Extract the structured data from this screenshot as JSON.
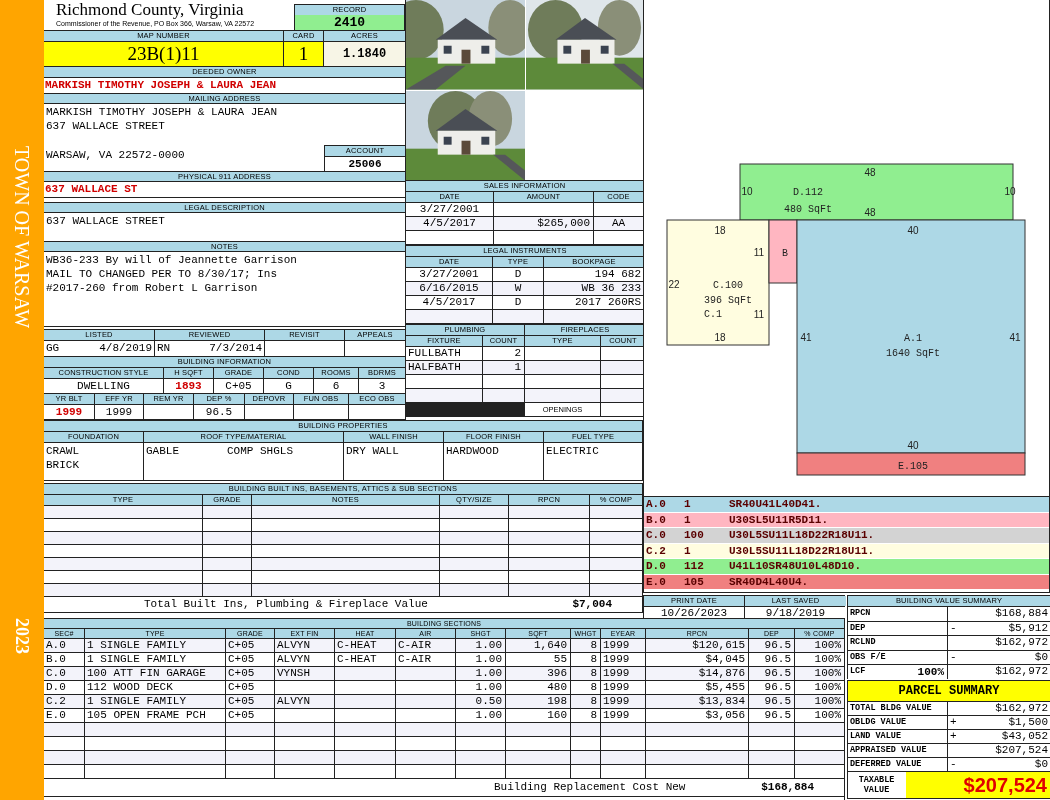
{
  "sidebar": {
    "town": "TOWN OF WARSAW",
    "year": "2023"
  },
  "header": {
    "county": "Richmond County, Virginia",
    "address": "Commissioner of the Revenue, PO Box 366, Warsaw, VA 22572"
  },
  "record": {
    "label": "RECORD",
    "value": "2410"
  },
  "map_number": {
    "label": "MAP NUMBER",
    "value": "23B(1)11"
  },
  "card": {
    "label": "CARD",
    "value": "1"
  },
  "acres": {
    "label": "ACRES",
    "value": "1.1840"
  },
  "deeded_owner": {
    "label": "DEEDED OWNER",
    "value": "MARKISH TIMOTHY JOSEPH & LAURA JEAN"
  },
  "mailing_address": {
    "label": "MAILING ADDRESS",
    "lines": [
      "MARKISH TIMOTHY JOSEPH & LAURA JEAN",
      "637 WALLACE STREET"
    ],
    "city_line": "WARSAW, VA 22572-0000"
  },
  "account": {
    "label": "ACCOUNT",
    "value": "25006"
  },
  "physical_address": {
    "label": "PHYSICAL 911 ADDRESS",
    "value": "637 WALLACE ST"
  },
  "legal_description": {
    "label": "LEGAL DESCRIPTION",
    "value": "637 WALLACE STREET"
  },
  "notes": {
    "label": "NOTES",
    "lines": [
      "WB36-233 By will of Jeannette Garrison",
      "MAIL TO CHANGED PER TO 8/30/17; Ins",
      "#2017-260 from Robert L Garrison"
    ]
  },
  "review": {
    "columns": [
      "LISTED",
      "REVIEWED",
      "REVISIT",
      "APPEALS"
    ],
    "listed_by": "GG",
    "listed_date": "4/8/2019",
    "reviewed_by": "RN",
    "reviewed_date": "7/3/2014"
  },
  "building_information": {
    "title": "BUILDING INFORMATION",
    "construction": [
      {
        "label": "CONSTRUCTION STYLE",
        "value": "DWELLING",
        "highlighted": false
      },
      {
        "label": "H SQFT",
        "value": "1893",
        "highlighted": true
      },
      {
        "label": "GRADE",
        "value": "C+05",
        "highlighted": false
      },
      {
        "label": "COND",
        "value": "G",
        "highlighted": false
      },
      {
        "label": "ROOMS",
        "value": "6",
        "highlighted": false
      },
      {
        "label": "BDRMS",
        "value": "3",
        "highlighted": false
      }
    ],
    "age": [
      {
        "label": "YR BLT",
        "value": "1999",
        "highlighted": true
      },
      {
        "label": "EFF YR",
        "value": "1999",
        "highlighted": false
      },
      {
        "label": "REM YR"
      },
      {
        "label": "DEP %",
        "value": "96.5",
        "highlighted": false
      },
      {
        "label": "DEPOVR"
      },
      {
        "label": "FUN OBS"
      },
      {
        "label": "ECO OBS"
      }
    ]
  },
  "sales": {
    "title": "SALES INFORMATION",
    "columns": [
      "DATE",
      "AMOUNT",
      "CODE"
    ],
    "rows": [
      {
        "date": "3/27/2001"
      },
      {
        "date": "4/5/2017",
        "amount": "$265,000",
        "code": "AA"
      }
    ]
  },
  "legal_instruments": {
    "title": "LEGAL INSTRUMENTS",
    "columns": [
      "DATE",
      "TYPE",
      "BOOKPAGE"
    ],
    "rows": [
      {
        "date": "3/27/2001",
        "type": "D",
        "bookpage": "194 682"
      },
      {
        "date": "6/16/2015",
        "type": "W",
        "bookpage": "WB 36 233"
      },
      {
        "date": "4/5/2017",
        "type": "D",
        "bookpage": "2017 260RS"
      }
    ]
  },
  "plumbing": {
    "title": "PLUMBING",
    "columns": [
      "FIXTURE",
      "COUNT"
    ],
    "rows": [
      {
        "fixture": "FULLBATH",
        "count": "2"
      },
      {
        "fixture": "HALFBATH",
        "count": "1"
      }
    ]
  },
  "fireplaces": {
    "title": "FIREPLACES",
    "columns": [
      "TYPE",
      "COUNT"
    ],
    "openings_label": "OPENINGS"
  },
  "building_properties": {
    "title": "BUILDING PROPERTIES",
    "columns": [
      {
        "label": "FOUNDATION",
        "values": [
          "CRAWL",
          "BRICK"
        ]
      },
      {
        "label": "ROOF TYPE/MATERIAL",
        "values": [
          "GABLE",
          "COMP SHGLS"
        ]
      },
      {
        "label": "WALL FINISH",
        "values": [
          "DRY WALL"
        ]
      },
      {
        "label": "FLOOR FINISH",
        "values": [
          "HARDWOOD"
        ]
      },
      {
        "label": "FUEL TYPE",
        "values": [
          "ELECTRIC"
        ]
      }
    ]
  },
  "built_ins": {
    "title": "BUILDING BUILT INS, BASEMENTS, ATTICS & SUB SECTIONS",
    "columns": [
      "TYPE",
      "GRADE",
      "NOTES",
      "QTY/SIZE",
      "RPCN",
      "% COMP"
    ],
    "total_label": "Total Built Ins, Plumbing & Fireplace Value",
    "total_value": "$7,004"
  },
  "sketch": {
    "areas": [
      {
        "code": "D.112",
        "sqft": "480 SqFt",
        "color": "#90ee90",
        "dims": [
          "48",
          "10",
          "10",
          "48"
        ]
      },
      {
        "code": "C.100",
        "sqft": "396 SqFt",
        "sub": "C.1",
        "color": "#fffde0",
        "dims": [
          "18",
          "11",
          "22",
          "11",
          "18"
        ]
      },
      {
        "code": "B",
        "color": "#ffb6c1"
      },
      {
        "code": "A.1",
        "sqft": "1640 SqFt",
        "color": "#add8e6",
        "dims": [
          "40",
          "41",
          "41",
          "40"
        ]
      },
      {
        "code": "E.105",
        "color": "#f08080"
      }
    ]
  },
  "legend": [
    {
      "section": "A.0",
      "code": "1",
      "traverse": "SR40U41L40D41.",
      "color": "#add8e6"
    },
    {
      "section": "B.0",
      "code": "1",
      "traverse": "U30SL5U11R5D11.",
      "color": "#ffb6c1"
    },
    {
      "section": "C.0",
      "code": "100",
      "traverse": "U30L5SU11L18D22R18U11.",
      "color": "#d3d3d3"
    },
    {
      "section": "C.2",
      "code": "1",
      "traverse": "U30L5SU11L18D22R18U11.",
      "color": "#fffde0"
    },
    {
      "section": "D.0",
      "code": "112",
      "traverse": "U41L10SR48U10L48D10.",
      "color": "#90ee90"
    },
    {
      "section": "E.0",
      "code": "105",
      "traverse": "SR40D4L40U4.",
      "color": "#f08080"
    }
  ],
  "print_date": {
    "label": "PRINT DATE",
    "value": "10/26/2023"
  },
  "last_saved": {
    "label": "LAST SAVED",
    "value": "9/18/2019"
  },
  "building_value_summary": {
    "title": "BUILDING VALUE SUMMARY",
    "rows": [
      {
        "label": "RPCN",
        "value": "$168,884"
      },
      {
        "label": "DEP",
        "sign": "-",
        "value": "$5,912"
      },
      {
        "label": "RCLND",
        "value": "$162,972"
      },
      {
        "label": "OBS F/E",
        "sign": "-",
        "value": "$0"
      },
      {
        "label": "LCF",
        "percent": "100%",
        "value": "$162,972"
      }
    ]
  },
  "building_sections": {
    "title": "BUILDING SECTIONS",
    "columns": [
      "SEC#",
      "TYPE",
      "GRADE",
      "EXT FIN",
      "HEAT",
      "AIR",
      "SHGT",
      "SQFT",
      "WHGT",
      "EYEAR",
      "RPCN",
      "DEP",
      "% COMP"
    ],
    "rows": [
      {
        "sec": "A.0",
        "type": "1 SINGLE FAMILY",
        "grade": "C+05",
        "ext_fin": "ALVYN",
        "heat": "C-HEAT",
        "air": "C-AIR",
        "shgt": "1.00",
        "sqft": "1,640",
        "whgt": "8",
        "eyear": "1999",
        "rpcn": "$120,615",
        "dep": "96.5",
        "comp": "100%"
      },
      {
        "sec": "B.0",
        "type": "1 SINGLE FAMILY",
        "grade": "C+05",
        "ext_fin": "ALVYN",
        "heat": "C-HEAT",
        "air": "C-AIR",
        "shgt": "1.00",
        "sqft": "55",
        "whgt": "8",
        "eyear": "1999",
        "rpcn": "$4,045",
        "dep": "96.5",
        "comp": "100%"
      },
      {
        "sec": "C.0",
        "type": "100 ATT FIN GARAGE",
        "grade": "C+05",
        "ext_fin": "VYNSH",
        "shgt": "1.00",
        "sqft": "396",
        "whgt": "8",
        "eyear": "1999",
        "rpcn": "$14,876",
        "dep": "96.5",
        "comp": "100%"
      },
      {
        "sec": "D.0",
        "type": "112 WOOD DECK",
        "grade": "C+05",
        "shgt": "1.00",
        "sqft": "480",
        "whgt": "8",
        "eyear": "1999",
        "rpcn": "$5,455",
        "dep": "96.5",
        "comp": "100%"
      },
      {
        "sec": "C.2",
        "type": "1 SINGLE FAMILY",
        "grade": "C+05",
        "ext_fin": "ALVYN",
        "shgt": "0.50",
        "sqft": "198",
        "whgt": "8",
        "eyear": "1999",
        "rpcn": "$13,834",
        "dep": "96.5",
        "comp": "100%"
      },
      {
        "sec": "E.0",
        "type": "105 OPEN FRAME PCH",
        "grade": "C+05",
        "shgt": "1.00",
        "sqft": "160",
        "whgt": "8",
        "eyear": "1999",
        "rpcn": "$3,056",
        "dep": "96.5",
        "comp": "100%"
      }
    ],
    "total_label": "Building Replacement Cost New",
    "total_value": "$168,884"
  },
  "parcel_summary": {
    "title": "PARCEL SUMMARY",
    "rows": [
      {
        "label": "TOTAL BLDG VALUE",
        "value": "$162,972"
      },
      {
        "label": "OBLDG VALUE",
        "sign": "+",
        "value": "$1,500"
      },
      {
        "label": "LAND VALUE",
        "sign": "+",
        "value": "$43,052"
      },
      {
        "label": "APPRAISED VALUE",
        "value": "$207,524"
      },
      {
        "label": "DEFERRED VALUE",
        "sign": "-",
        "value": "$0"
      }
    ],
    "taxable_label": "TAXABLE VALUE",
    "taxable_value": "$207,524"
  }
}
